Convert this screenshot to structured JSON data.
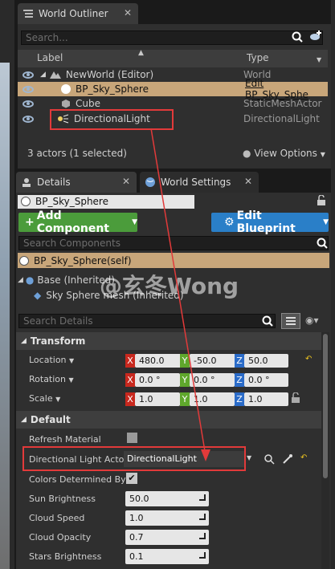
{
  "outliner": {
    "tab_title": "World Outliner",
    "search_placeholder": "Search...",
    "col_label": "Label",
    "col_type": "Type",
    "items": [
      {
        "label": "NewWorld (Editor)",
        "type": "World"
      },
      {
        "label": "BP_Sky_Sphere",
        "type": "Edit BP_Sky_Sphe"
      },
      {
        "label": "Cube",
        "type": "StaticMeshActor"
      },
      {
        "label": "DirectionalLight",
        "type": "DirectionalLight"
      }
    ],
    "status": "3 actors (1 selected)",
    "view_options": "View Options"
  },
  "details": {
    "tab_details": "Details",
    "tab_world_settings": "World Settings",
    "actor_name": "BP_Sky_Sphere",
    "add_component": "Add Component",
    "edit_blueprint": "Edit Blueprint",
    "search_components": "Search Components",
    "self_component": "BP_Sky_Sphere(self)",
    "base_inherited": "Base (Inherited)",
    "sky_mesh": "Sky Sphere mesh (Inherited)",
    "watermark": "@玄冬Wong",
    "search_details": "Search Details",
    "transform_title": "Transform",
    "location_label": "Location",
    "rotation_label": "Rotation",
    "scale_label": "Scale",
    "location": {
      "x": "480.0",
      "y": "-50.0",
      "z": "50.0"
    },
    "rotation": {
      "x": "0.0 °",
      "y": "0.0 °",
      "z": "0.0 °"
    },
    "scale": {
      "x": "1.0",
      "y": "1.0",
      "z": "1.0"
    },
    "default_title": "Default",
    "refresh_material": "Refresh Material",
    "dir_light_actor_label": "Directional Light Actor",
    "dir_light_actor_value": "DirectionalLight",
    "colors_determined": "Colors Determined By S",
    "sun_brightness_label": "Sun Brightness",
    "sun_brightness": "50.0",
    "cloud_speed_label": "Cloud Speed",
    "cloud_speed": "1.0",
    "cloud_opacity_label": "Cloud Opacity",
    "cloud_opacity": "0.7",
    "stars_brightness_label": "Stars Brightness",
    "stars_brightness": "0.1"
  },
  "colors": {
    "accent_green": "#4b9c3b",
    "accent_blue": "#2a7fc8",
    "highlight_red": "#e23a3a",
    "selection": "#c8a67a"
  }
}
